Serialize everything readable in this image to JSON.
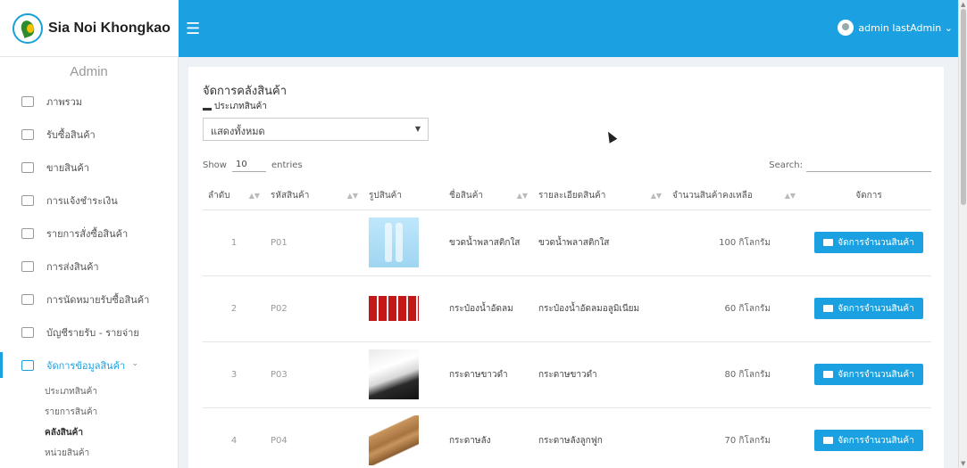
{
  "brand": {
    "name": "Sia Noi Khongkao"
  },
  "user": {
    "name": "admin lastAdmin ⌄"
  },
  "sidebar": {
    "title": "Admin",
    "items": [
      {
        "label": "ภาพรวม"
      },
      {
        "label": "รับซื้อสินค้า"
      },
      {
        "label": "ขายสินค้า"
      },
      {
        "label": "การแจ้งชำระเงิน"
      },
      {
        "label": "รายการสั่งซื้อสินค้า"
      },
      {
        "label": "การส่งสินค้า"
      },
      {
        "label": "การนัดหมายรับซื้อสินค้า"
      },
      {
        "label": "บัญชีรายรับ - รายจ่าย"
      },
      {
        "label": "จัดการข้อมูลสินค้า"
      }
    ],
    "submenu": [
      {
        "label": "ประเภทสินค้า"
      },
      {
        "label": "รายการสินค้า"
      },
      {
        "label": "คลังสินค้า"
      },
      {
        "label": "หน่วยสินค้า"
      }
    ]
  },
  "main": {
    "title": "จัดการคลังสินค้า",
    "filter_label": "ประเภทสินค้า",
    "filter_value": "แสดงทั้งหมด",
    "show_label": "Show",
    "show_value": "10",
    "entries_label": "entries",
    "search_label": "Search:",
    "columns": [
      "ลำดับ",
      "รหัสสินค้า",
      "รูปสินค้า",
      "ชื่อสินค้า",
      "รายละเอียดสินค้า",
      "จำนวนสินค้าคงเหลือ",
      "จัดการ"
    ],
    "rows": [
      {
        "no": "1",
        "code": "P01",
        "name": "ขวดน้ำพลาสติกใส",
        "detail": "ขวดน้ำพลาสติกใส",
        "qty": "100 กิโลกรัม",
        "action": "จัดการจำนวนสินค้า"
      },
      {
        "no": "2",
        "code": "P02",
        "name": "กระป๋องน้ำอัดลม",
        "detail": "กระป๋องน้ำอัดลมอลูมิเนียม",
        "qty": "60 กิโลกรัม",
        "action": "จัดการจำนวนสินค้า"
      },
      {
        "no": "3",
        "code": "P03",
        "name": "กระดาษขาวดำ",
        "detail": "กระดาษขาวดำ",
        "qty": "80 กิโลกรัม",
        "action": "จัดการจำนวนสินค้า"
      },
      {
        "no": "4",
        "code": "P04",
        "name": "กระดาษลัง",
        "detail": "กระดาษลังลูกฟูก",
        "qty": "70 กิโลกรัม",
        "action": "จัดการจำนวนสินค้า"
      }
    ]
  },
  "colors": {
    "accent": "#1ba1e2",
    "sidebar_bg": "#ffffff",
    "page_bg": "#eef1f5"
  }
}
